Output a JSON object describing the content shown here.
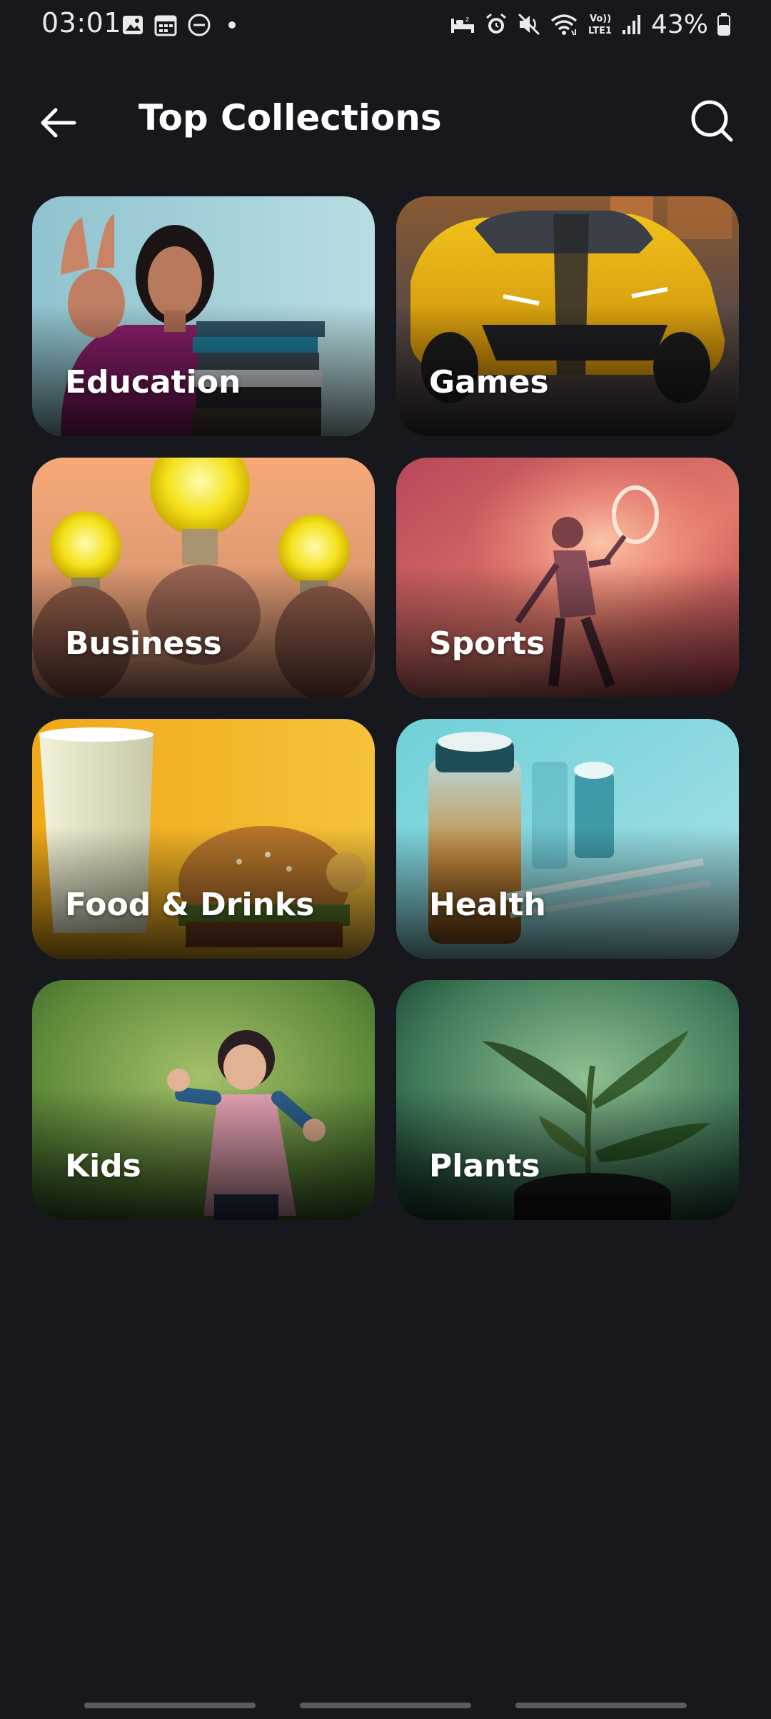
{
  "status_bar": {
    "time": "03:01",
    "battery_percent": "43%",
    "left_icons": [
      "gallery-icon",
      "calendar-icon",
      "do-not-disturb-icon",
      "dot-icon"
    ],
    "right_icons": [
      "sleep-mode-icon",
      "alarm-icon",
      "mute-icon",
      "wifi-icon",
      "volte-icon",
      "signal-icon",
      "battery-icon"
    ],
    "volte_text": "Vo))\nLTE1"
  },
  "app_bar": {
    "title": "Top Collections",
    "back_icon": "arrow-left-icon",
    "search_icon": "search-icon"
  },
  "collections": [
    {
      "label": "Education"
    },
    {
      "label": "Games"
    },
    {
      "label": "Business"
    },
    {
      "label": "Sports"
    },
    {
      "label": "Food & Drinks"
    },
    {
      "label": "Health"
    },
    {
      "label": "Kids"
    },
    {
      "label": "Plants"
    }
  ],
  "colors": {
    "background": "#17181d",
    "title_text": "#ffffff",
    "nav_handle": "#5b5c62"
  }
}
